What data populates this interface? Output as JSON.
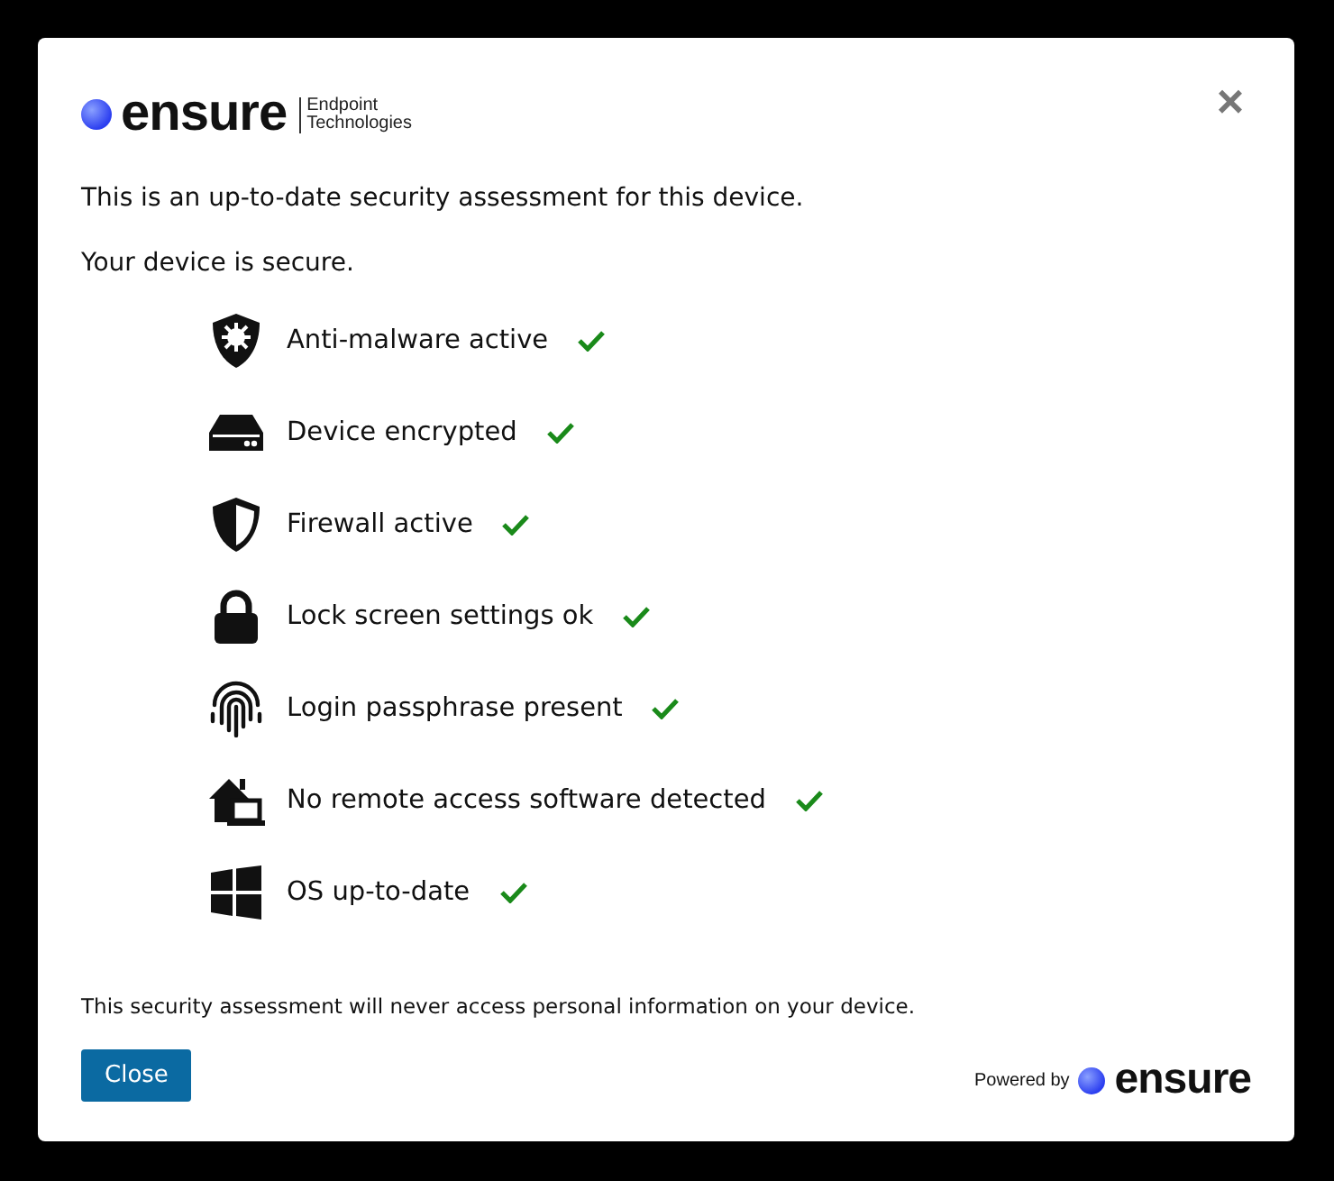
{
  "header": {
    "logo": {
      "wordmark": "ensure",
      "tagline": [
        "Endpoint",
        "Technologies"
      ]
    },
    "close_icon": "×"
  },
  "intro": "This is an up-to-date security assessment for this device.",
  "status": "Your device is secure.",
  "checks": [
    {
      "kind": "antimalware",
      "label": "Anti-malware active",
      "passed": true
    },
    {
      "kind": "encryption",
      "label": "Device encrypted",
      "passed": true
    },
    {
      "kind": "firewall",
      "label": "Firewall active",
      "passed": true
    },
    {
      "kind": "lock",
      "label": "Lock screen settings ok",
      "passed": true
    },
    {
      "kind": "passphrase",
      "label": "Login passphrase present",
      "passed": true
    },
    {
      "kind": "remote",
      "label": "No remote access software detected",
      "passed": true
    },
    {
      "kind": "os",
      "label": "OS up-to-date",
      "passed": true
    }
  ],
  "note": "This security assessment will never access personal information on your device.",
  "buttons": [
    "Close"
  ],
  "footer": {
    "powered_by": "Powered by",
    "wordmark": "ensure"
  }
}
